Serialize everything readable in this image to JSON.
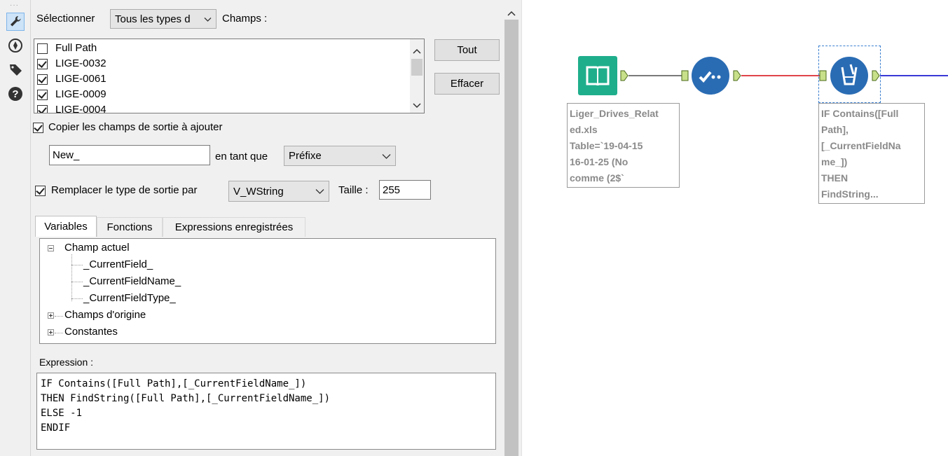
{
  "toolbar_rail": {
    "icons": [
      "wrench-icon",
      "navigate-icon",
      "tag-icon",
      "help-icon"
    ]
  },
  "config": {
    "select_label": "Sélectionner",
    "select_value": "Tous les types d",
    "fields_label": "Champs :",
    "fields": [
      {
        "name": "Full Path",
        "checked": false
      },
      {
        "name": "LIGE-0032",
        "checked": true
      },
      {
        "name": "LIGE-0061",
        "checked": true
      },
      {
        "name": "LIGE-0009",
        "checked": true
      },
      {
        "name": "LIGE-0004",
        "checked": true
      }
    ],
    "all_button": "Tout",
    "clear_button": "Effacer",
    "copy_output_label": "Copier les champs de sortie à ajouter",
    "copy_output_checked": true,
    "prefix_value": "New_",
    "as_label": "en tant que",
    "prefix_mode": "Préfixe",
    "replace_type_label": "Remplacer le type de sortie par",
    "replace_type_checked": true,
    "type_value": "V_WString",
    "size_label": "Taille :",
    "size_value": "255",
    "tabs": [
      "Variables",
      "Fonctions",
      "Expressions enregistrées"
    ],
    "active_tab": "Variables",
    "tree": {
      "current_field_group": "Champ actuel",
      "current_field_items": [
        "_CurrentField_",
        "_CurrentFieldName_",
        "_CurrentFieldType_"
      ],
      "original_fields_group": "Champs d'origine",
      "constants_group": "Constantes"
    },
    "expression_label": "Expression :",
    "expression_lines": [
      "IF Contains([Full Path],[_CurrentFieldName_])",
      "THEN FindString([Full Path],[_CurrentFieldName_])",
      "ELSE -1",
      "ENDIF"
    ]
  },
  "canvas": {
    "input_annotation": [
      "Liger_Drives_Relat",
      "ed.xls",
      "Table=`19-04-15",
      "16-01-25 (No",
      "comme (2$`"
    ],
    "formula_annotation": [
      "IF Contains([Full",
      "Path],",
      "[_CurrentFieldNa",
      "me_])",
      "THEN",
      "FindString..."
    ],
    "colors": {
      "input_tool": "#1fae8c",
      "select_tool": "#2a6cb4",
      "formula_tool": "#2a6cb4",
      "connector_red": "#e0444a",
      "connector_blue": "#3a3ad6",
      "anchor": "#c8e08a"
    }
  }
}
